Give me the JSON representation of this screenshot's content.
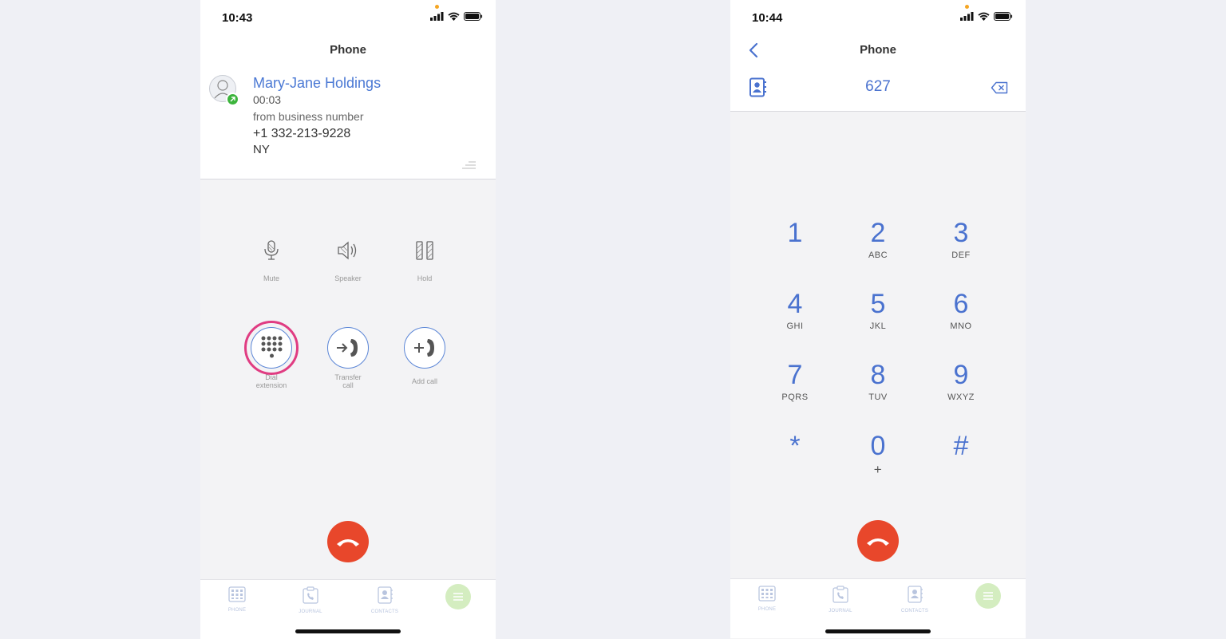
{
  "left": {
    "status": {
      "time": "10:43"
    },
    "header": {
      "title": "Phone"
    },
    "call": {
      "name": "Mary-Jane Holdings",
      "duration": "00:03",
      "from": "from business number",
      "number": "+1 332-213-9228",
      "region": "NY"
    },
    "controls": [
      {
        "label": "Mute",
        "icon": "microphone-icon"
      },
      {
        "label": "Speaker",
        "icon": "speaker-icon"
      },
      {
        "label": "Hold",
        "icon": "pause-icon"
      }
    ],
    "actions": [
      {
        "line1": "Dial",
        "line2": "extension",
        "icon": "dialpad-icon",
        "highlighted": true
      },
      {
        "line1": "Transfer",
        "line2": "call",
        "icon": "transfer-call-icon"
      },
      {
        "line1": "Add call",
        "line2": "",
        "icon": "add-call-icon"
      }
    ]
  },
  "right": {
    "status": {
      "time": "10:44"
    },
    "header": {
      "title": "Phone"
    },
    "dial_value": "627",
    "keys": [
      {
        "digit": "1",
        "letters": ""
      },
      {
        "digit": "2",
        "letters": "ABC"
      },
      {
        "digit": "3",
        "letters": "DEF"
      },
      {
        "digit": "4",
        "letters": "GHI"
      },
      {
        "digit": "5",
        "letters": "JKL"
      },
      {
        "digit": "6",
        "letters": "MNO"
      },
      {
        "digit": "7",
        "letters": "PQRS"
      },
      {
        "digit": "8",
        "letters": "TUV"
      },
      {
        "digit": "9",
        "letters": "WXYZ"
      },
      {
        "digit": "*",
        "letters": ""
      },
      {
        "digit": "0",
        "letters": "+"
      },
      {
        "digit": "#",
        "letters": ""
      }
    ]
  },
  "tabbar": {
    "phone": "PHONE",
    "journal": "JOURNAL",
    "contacts": "CONTACTS"
  },
  "colors": {
    "accent": "#4a72cf",
    "hangup": "#e8472b",
    "highlight": "#e03c82",
    "online": "#3cb43c",
    "menu": "#d4edc0"
  }
}
